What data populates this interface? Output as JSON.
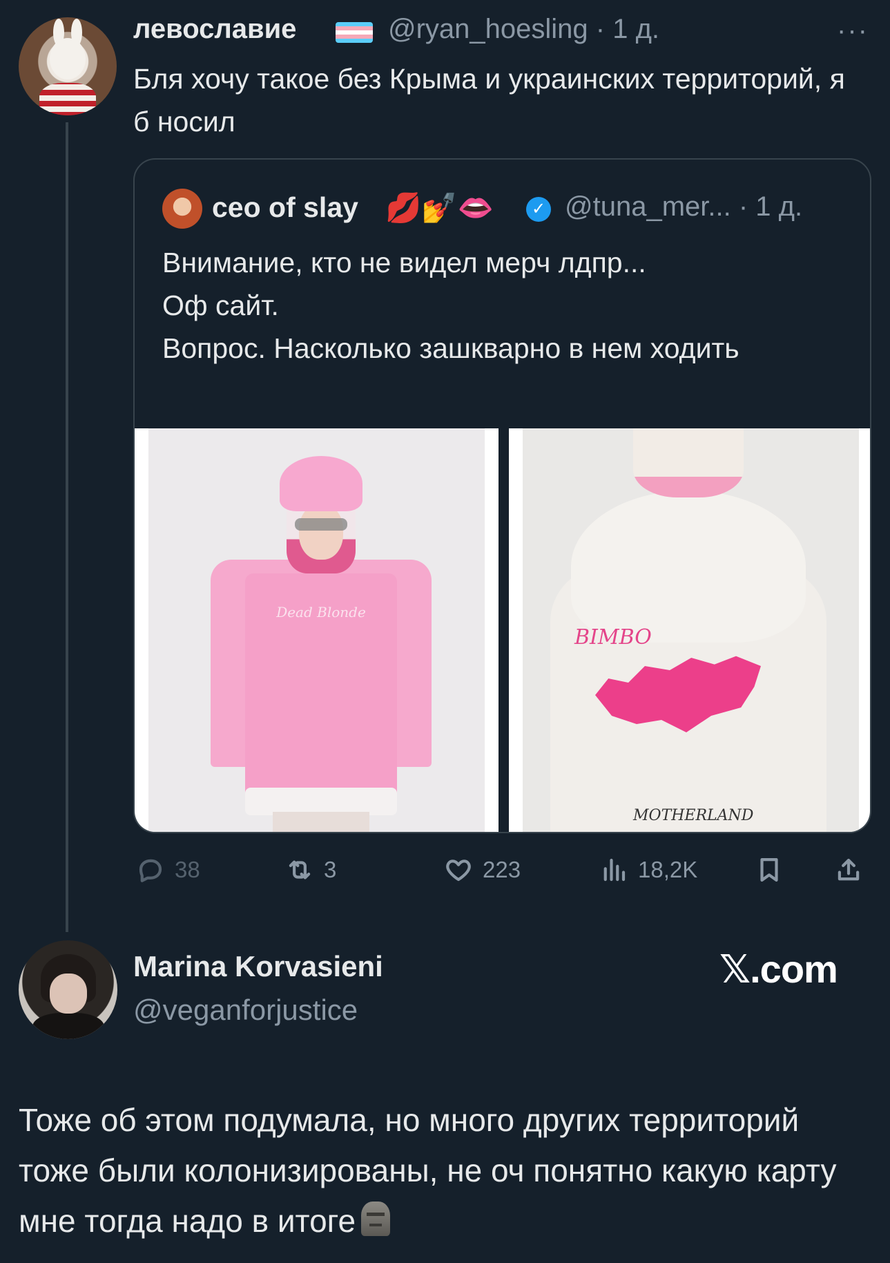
{
  "tweet": {
    "author_name": "левославие",
    "handle_time": "@ryan_hoesling · 1 д.",
    "more": "···",
    "text": "Бля хочу такое без Крыма и украинских территорий, я б носил"
  },
  "quoted": {
    "author_name": "ceo of slay",
    "emojis": "💋💅👄",
    "verified": "✓",
    "handle_time": "@tuna_mer... · 1 д.",
    "lines": [
      "Внимание, кто не видел мерч лдпр...",
      "Оф сайт.",
      "Вопрос. Насколько зашкварно в нем ходить"
    ],
    "image_left_print": "Dead Blonde",
    "image_right_print_top": "BIMBO",
    "image_right_print_bottom": "MOTHERLAND"
  },
  "actions": {
    "replies": "38",
    "retweets": "3",
    "likes": "223",
    "views": "18,2K"
  },
  "reply": {
    "author_name": "Marina Korvasieni",
    "handle": "@veganforjustice",
    "brand": "𝕏.com",
    "text": "Тоже об этом подумала, но много других территорий тоже были колонизированы, не оч понятно какую карту мне тогда надо в итоге"
  },
  "colors": {
    "background": "#15202b",
    "text": "#e7e9ea",
    "muted": "#8b98a5",
    "border": "#38444d",
    "verified": "#1d9bf0"
  }
}
